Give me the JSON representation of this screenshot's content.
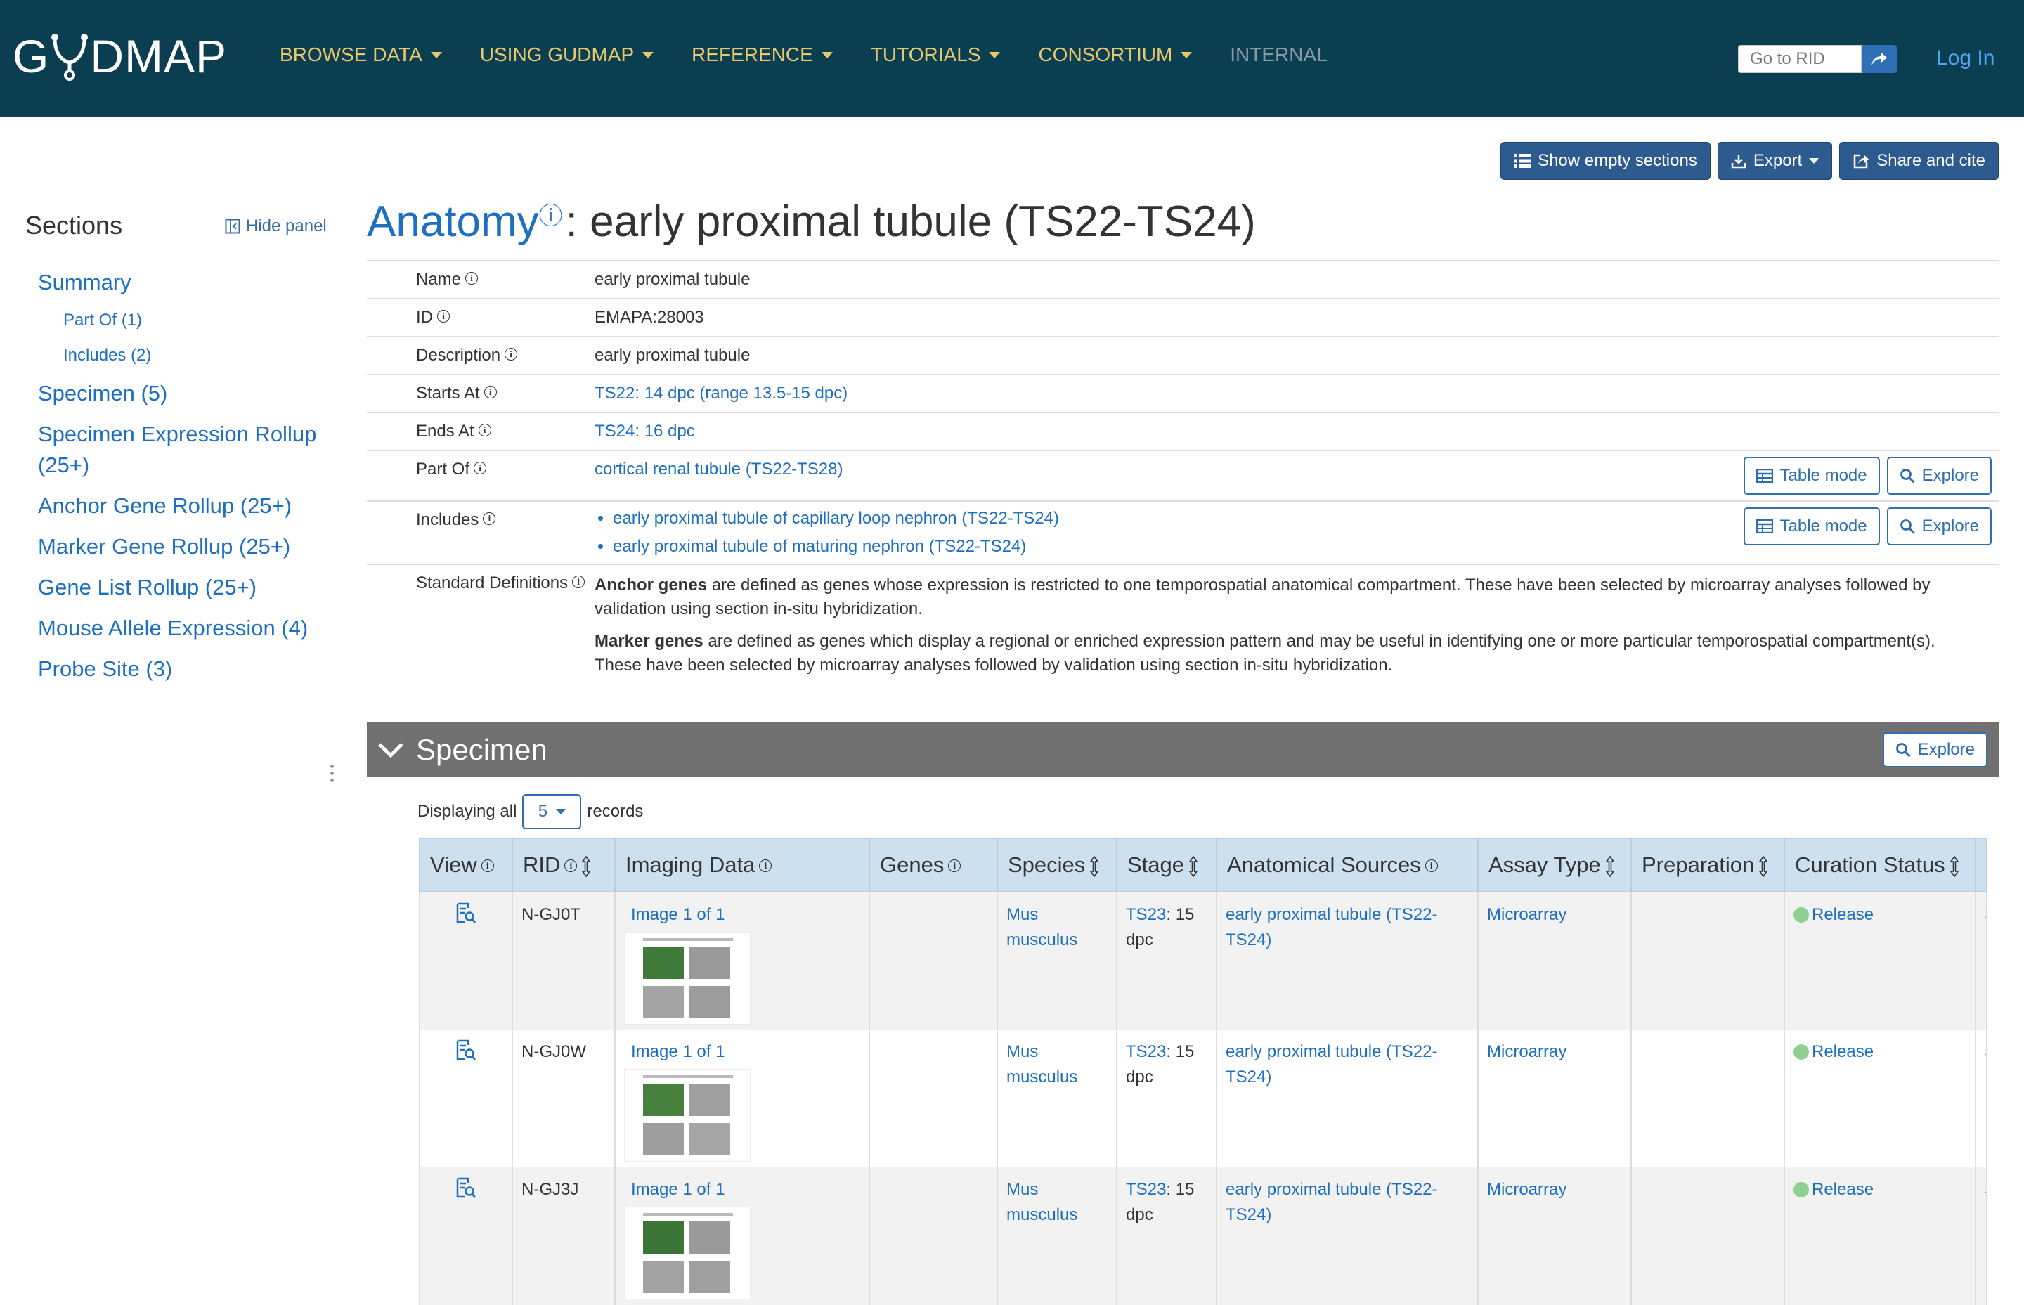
{
  "header": {
    "logo_left": "G",
    "logo_right": "DMAP",
    "nav": [
      {
        "label": "BROWSE DATA",
        "dropdown": true
      },
      {
        "label": "USING GUDMAP",
        "dropdown": true
      },
      {
        "label": "REFERENCE",
        "dropdown": true
      },
      {
        "label": "TUTORIALS",
        "dropdown": true
      },
      {
        "label": "CONSORTIUM",
        "dropdown": true
      },
      {
        "label": "INTERNAL",
        "dropdown": false
      }
    ],
    "rid_placeholder": "Go to RID",
    "login": "Log In",
    "colors": {
      "bar": "#0c3e51",
      "nav_text": "#e7c96c",
      "login": "#4aa7f0"
    }
  },
  "actions": {
    "show_empty": "Show empty sections",
    "export": "Export",
    "share": "Share and cite"
  },
  "sidebar": {
    "title": "Sections",
    "hide": "Hide panel",
    "items": [
      {
        "label": "Summary",
        "level": 1
      },
      {
        "label": "Part Of (1)",
        "level": 2
      },
      {
        "label": "Includes (2)",
        "level": 2
      },
      {
        "label": "Specimen (5)",
        "level": 1
      },
      {
        "label": "Specimen Expression Rollup (25+)",
        "level": 1
      },
      {
        "label": "Anchor Gene Rollup (25+)",
        "level": 1
      },
      {
        "label": "Marker Gene Rollup (25+)",
        "level": 1
      },
      {
        "label": "Gene List Rollup (25+)",
        "level": 1
      },
      {
        "label": "Mouse Allele Expression (4)",
        "level": 1
      },
      {
        "label": "Probe Site (3)",
        "level": 1
      }
    ]
  },
  "title": {
    "entity": "Anatomy",
    "rest": ": early proximal tubule (TS22-TS24)"
  },
  "record": {
    "name_key": "Name",
    "name_val": "early proximal tubule",
    "id_key": "ID",
    "id_val": "EMAPA:28003",
    "desc_key": "Description",
    "desc_val": "early proximal tubule",
    "starts_key": "Starts At",
    "starts_val": "TS22: 14 dpc (range 13.5-15 dpc)",
    "ends_key": "Ends At",
    "ends_val": "TS24: 16 dpc",
    "partof_key": "Part Of",
    "partof_val": "cortical renal tubule (TS22-TS28)",
    "includes_key": "Includes",
    "includes": [
      "early proximal tubule of capillary loop nephron (TS22-TS24)",
      "early proximal tubule of maturing nephron (TS22-TS24)"
    ],
    "defs_key": "Standard Definitions",
    "anchor_bold": "Anchor genes",
    "anchor_text": " are defined as genes whose expression is restricted to one temporospatial anatomical compartment. These have been selected by microarray analyses followed by validation using section in-situ hybridization.",
    "marker_bold": "Marker genes",
    "marker_text": " are defined as genes which display a regional or enriched expression pattern and may be useful in identifying one or more particular temporospatial compartment(s). These have been selected by microarray analyses followed by validation using section in-situ hybridization.",
    "table_mode": "Table mode",
    "explore": "Explore"
  },
  "specimen": {
    "title": "Specimen",
    "explore": "Explore",
    "displaying": "Displaying all",
    "count": "5",
    "records": "records",
    "columns": [
      "View",
      "RID",
      "Imaging Data",
      "Genes",
      "Species",
      "Stage",
      "Anatomical Sources",
      "Assay Type",
      "Preparation",
      "Curation Status",
      "P"
    ],
    "rows": [
      {
        "rid": "N-GJ0T",
        "image": "Image 1 of 1",
        "genes": "",
        "species": "Mus musculus",
        "stage_link": "TS23",
        "stage_rest": ": 15 dpc",
        "anat": "early proximal tubule (TS22-TS24)",
        "assay": "Microarray",
        "prep": "",
        "status": "Release",
        "extra": "S"
      },
      {
        "rid": "N-GJ0W",
        "image": "Image 1 of 1",
        "genes": "",
        "species": "Mus musculus",
        "stage_link": "TS23",
        "stage_rest": ": 15 dpc",
        "anat": "early proximal tubule (TS22-TS24)",
        "assay": "Microarray",
        "prep": "",
        "status": "Release",
        "extra": "S"
      },
      {
        "rid": "N-GJ3J",
        "image": "Image 1 of 1",
        "genes": "",
        "species": "Mus musculus",
        "stage_link": "TS23",
        "stage_rest": ": 15 dpc",
        "anat": "early proximal tubule (TS22-TS24)",
        "assay": "Microarray",
        "prep": "",
        "status": "Release",
        "extra": "S"
      }
    ]
  }
}
